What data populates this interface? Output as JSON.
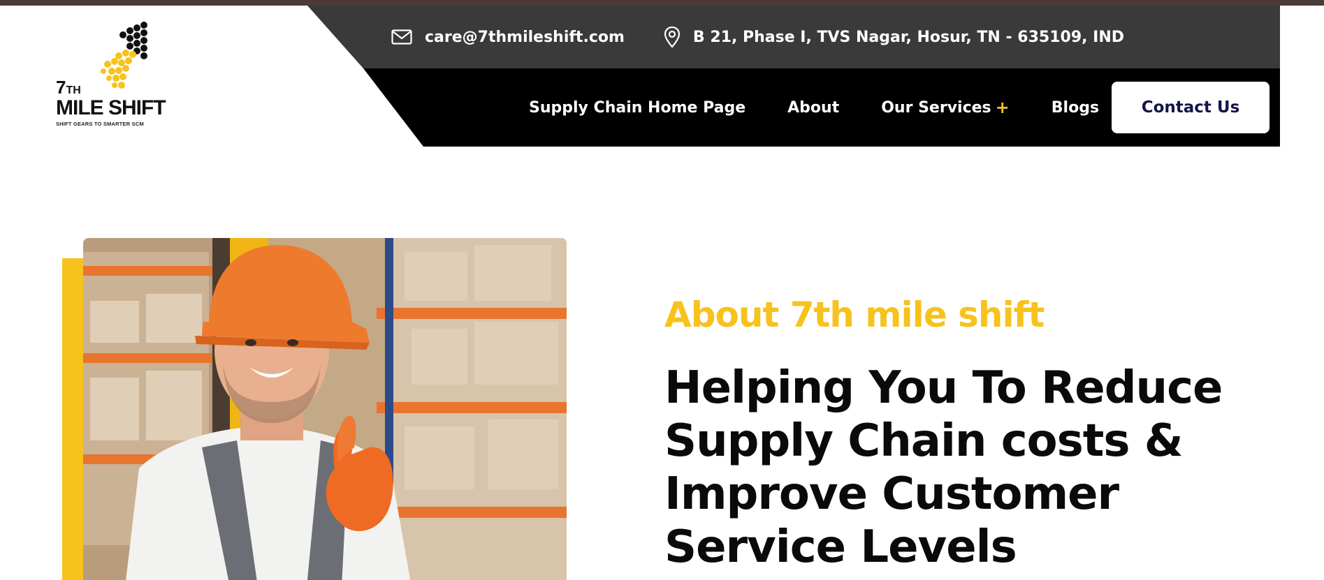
{
  "colors": {
    "accent": "#f7c21c",
    "dark_bar": "#3a3a3a",
    "nav_bg": "#000000",
    "button_text": "#15154a"
  },
  "logo": {
    "number": "7",
    "suffix": "TH",
    "name": "MILE SHIFT",
    "tagline": "SHIFT GEARS TO SMARTER SCM"
  },
  "contact_info": {
    "email": "care@7thmileshift.com",
    "email_icon": "mail-icon",
    "address": "B 21, Phase I, TVS Nagar, Hosur, TN - 635109, IND",
    "address_icon": "location-pin-icon"
  },
  "nav": {
    "items": [
      {
        "label": "Supply Chain Home Page"
      },
      {
        "label": "About"
      },
      {
        "label": "Our Services",
        "expand_symbol": "+"
      },
      {
        "label": "Blogs"
      }
    ],
    "contact_button": "Contact Us"
  },
  "hero": {
    "about_label": "About 7th mile shift",
    "headline": "Helping You To Reduce Supply Chain costs & Improve Customer Service Levels",
    "image_alt": "warehouse-worker-thumbs-up"
  }
}
